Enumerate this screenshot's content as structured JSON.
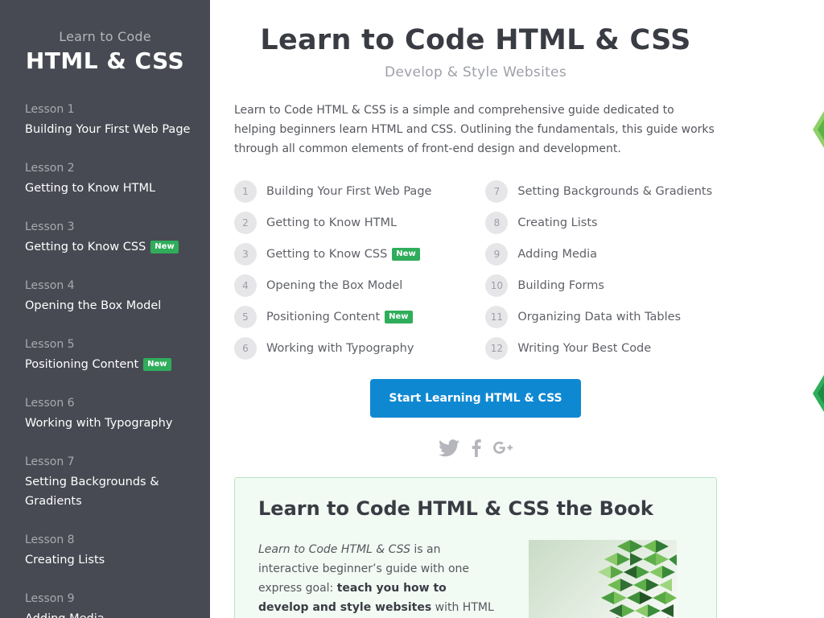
{
  "sidebar": {
    "subtitle": "Learn to Code",
    "title": "HTML & CSS",
    "items": [
      {
        "num": "Lesson 1",
        "name": "Building Your First Web Page",
        "badge": ""
      },
      {
        "num": "Lesson 2",
        "name": "Getting to Know HTML",
        "badge": ""
      },
      {
        "num": "Lesson 3",
        "name": "Getting to Know CSS",
        "badge": "New"
      },
      {
        "num": "Lesson 4",
        "name": "Opening the Box Model",
        "badge": ""
      },
      {
        "num": "Lesson 5",
        "name": "Positioning Content",
        "badge": "New"
      },
      {
        "num": "Lesson 6",
        "name": "Working with Typography",
        "badge": ""
      },
      {
        "num": "Lesson 7",
        "name": "Setting Backgrounds & Gradients",
        "badge": ""
      },
      {
        "num": "Lesson 8",
        "name": "Creating Lists",
        "badge": ""
      },
      {
        "num": "Lesson 9",
        "name": "Adding Media",
        "badge": ""
      }
    ]
  },
  "main": {
    "title": "Learn to Code HTML & CSS",
    "subtitle": "Develop & Style Websites",
    "intro": "Learn to Code HTML & CSS is a simple and comprehensive guide dedicated to helping beginners learn HTML and CSS. Outlining the fundamentals, this guide works through all common elements of front-end design and development.",
    "lessons": [
      {
        "num": "1",
        "name": "Building Your First Web Page",
        "badge": ""
      },
      {
        "num": "2",
        "name": "Getting to Know HTML",
        "badge": ""
      },
      {
        "num": "3",
        "name": "Getting to Know CSS",
        "badge": "New"
      },
      {
        "num": "4",
        "name": "Opening the Box Model",
        "badge": ""
      },
      {
        "num": "5",
        "name": "Positioning Content",
        "badge": "New"
      },
      {
        "num": "6",
        "name": "Working with Typography",
        "badge": ""
      },
      {
        "num": "7",
        "name": "Setting Backgrounds & Gradients",
        "badge": ""
      },
      {
        "num": "8",
        "name": "Creating Lists",
        "badge": ""
      },
      {
        "num": "9",
        "name": "Adding Media",
        "badge": ""
      },
      {
        "num": "10",
        "name": "Building Forms",
        "badge": ""
      },
      {
        "num": "11",
        "name": "Organizing Data with Tables",
        "badge": ""
      },
      {
        "num": "12",
        "name": "Writing Your Best Code",
        "badge": ""
      }
    ],
    "start_button": "Start Learning HTML & CSS",
    "social_icons": [
      "twitter-icon",
      "facebook-icon",
      "google-plus-icon"
    ]
  },
  "book": {
    "title": "Learn to Code HTML & CSS the Book",
    "text_em": "Learn to Code HTML & CSS",
    "text_1": " is an interactive beginner’s guide with one express goal: ",
    "text_strong": "teach you how to develop and style websites",
    "text_2": " with HTML and CSS."
  },
  "colors": {
    "sidebar_bg": "#484a53",
    "accent_blue": "#0f88d2",
    "badge_green": "#2fad5b",
    "book_bg": "#f1faf3"
  }
}
